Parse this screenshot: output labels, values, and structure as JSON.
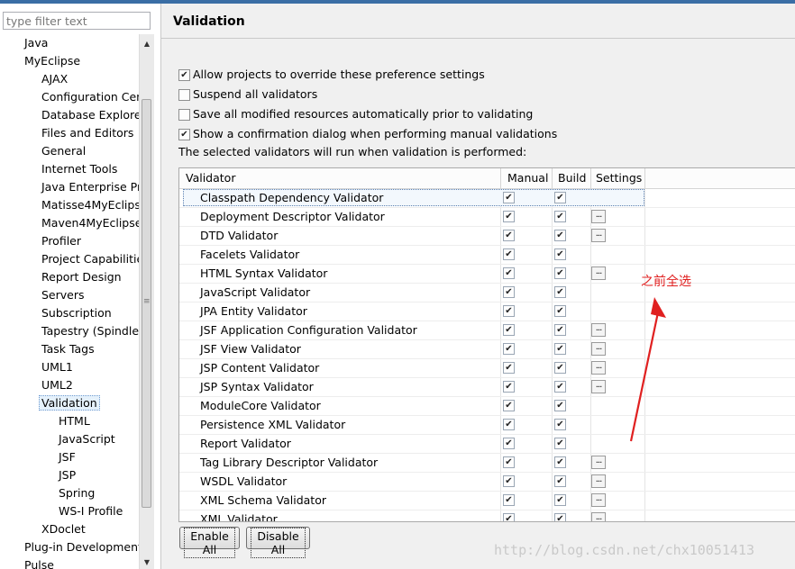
{
  "filter": {
    "placeholder": "type filter text"
  },
  "tree": [
    {
      "label": "Java",
      "depth": 1
    },
    {
      "label": "MyEclipse",
      "depth": 1
    },
    {
      "label": "AJAX",
      "depth": 2
    },
    {
      "label": "Configuration Cen",
      "depth": 2
    },
    {
      "label": "Database Explorer",
      "depth": 2
    },
    {
      "label": "Files and Editors",
      "depth": 2
    },
    {
      "label": "General",
      "depth": 2
    },
    {
      "label": "Internet Tools",
      "depth": 2
    },
    {
      "label": "Java Enterprise Pr",
      "depth": 2
    },
    {
      "label": "Matisse4MyEclipse",
      "depth": 2
    },
    {
      "label": "Maven4MyEclipse",
      "depth": 2
    },
    {
      "label": "Profiler",
      "depth": 2
    },
    {
      "label": "Project Capabilitie",
      "depth": 2
    },
    {
      "label": "Report Design",
      "depth": 2
    },
    {
      "label": "Servers",
      "depth": 2
    },
    {
      "label": "Subscription",
      "depth": 2
    },
    {
      "label": "Tapestry (Spindle)",
      "depth": 2
    },
    {
      "label": "Task Tags",
      "depth": 2
    },
    {
      "label": "UML1",
      "depth": 2
    },
    {
      "label": "UML2",
      "depth": 2
    },
    {
      "label": "Validation",
      "depth": 2,
      "selected": true
    },
    {
      "label": "HTML",
      "depth": 3
    },
    {
      "label": "JavaScript",
      "depth": 3
    },
    {
      "label": "JSF",
      "depth": 3
    },
    {
      "label": "JSP",
      "depth": 3
    },
    {
      "label": "Spring",
      "depth": 3
    },
    {
      "label": "WS-I Profile",
      "depth": 3
    },
    {
      "label": "XDoclet",
      "depth": 2
    },
    {
      "label": "Plug-in Development",
      "depth": 1
    },
    {
      "label": "Pulse",
      "depth": 1
    }
  ],
  "page_title": "Validation",
  "options": [
    {
      "label": "Allow projects to override these preference settings",
      "checked": true
    },
    {
      "label": "Suspend all validators",
      "checked": false
    },
    {
      "label": "Save all modified resources automatically prior to validating",
      "checked": false
    },
    {
      "label": "Show a confirmation dialog when performing manual validations",
      "checked": true
    }
  ],
  "performed_text": "The selected validators will run when validation is performed:",
  "columns": {
    "validator": "Validator",
    "manual": "Manual",
    "build": "Build",
    "settings": "Settings"
  },
  "validators": [
    {
      "name": "Classpath Dependency Validator",
      "manual": true,
      "build": true,
      "settings": false,
      "selected": true
    },
    {
      "name": "Deployment Descriptor Validator",
      "manual": true,
      "build": true,
      "settings": true
    },
    {
      "name": "DTD Validator",
      "manual": true,
      "build": true,
      "settings": true
    },
    {
      "name": "Facelets Validator",
      "manual": true,
      "build": true,
      "settings": false
    },
    {
      "name": "HTML Syntax Validator",
      "manual": true,
      "build": true,
      "settings": true
    },
    {
      "name": "JavaScript Validator",
      "manual": true,
      "build": true,
      "settings": false
    },
    {
      "name": "JPA Entity Validator",
      "manual": true,
      "build": true,
      "settings": false
    },
    {
      "name": "JSF Application Configuration Validator",
      "manual": true,
      "build": true,
      "settings": true
    },
    {
      "name": "JSF View Validator",
      "manual": true,
      "build": true,
      "settings": true
    },
    {
      "name": "JSP Content Validator",
      "manual": true,
      "build": true,
      "settings": true
    },
    {
      "name": "JSP Syntax Validator",
      "manual": true,
      "build": true,
      "settings": true
    },
    {
      "name": "ModuleCore Validator",
      "manual": true,
      "build": true,
      "settings": false
    },
    {
      "name": "Persistence XML Validator",
      "manual": true,
      "build": true,
      "settings": false
    },
    {
      "name": "Report Validator",
      "manual": true,
      "build": true,
      "settings": false
    },
    {
      "name": "Tag Library Descriptor Validator",
      "manual": true,
      "build": true,
      "settings": true
    },
    {
      "name": "WSDL Validator",
      "manual": true,
      "build": true,
      "settings": true
    },
    {
      "name": "XML Schema Validator",
      "manual": true,
      "build": true,
      "settings": true
    },
    {
      "name": "XML Validator",
      "manual": true,
      "build": true,
      "settings": true
    }
  ],
  "settings_button": "...",
  "buttons": {
    "enable_all": "Enable All",
    "disable_all": "Disable All"
  },
  "annotation": "之前全选",
  "watermark": "http://blog.csdn.net/chx10051413",
  "colors": {
    "annotation": "#e02020",
    "selection": "#e5f1fb"
  }
}
